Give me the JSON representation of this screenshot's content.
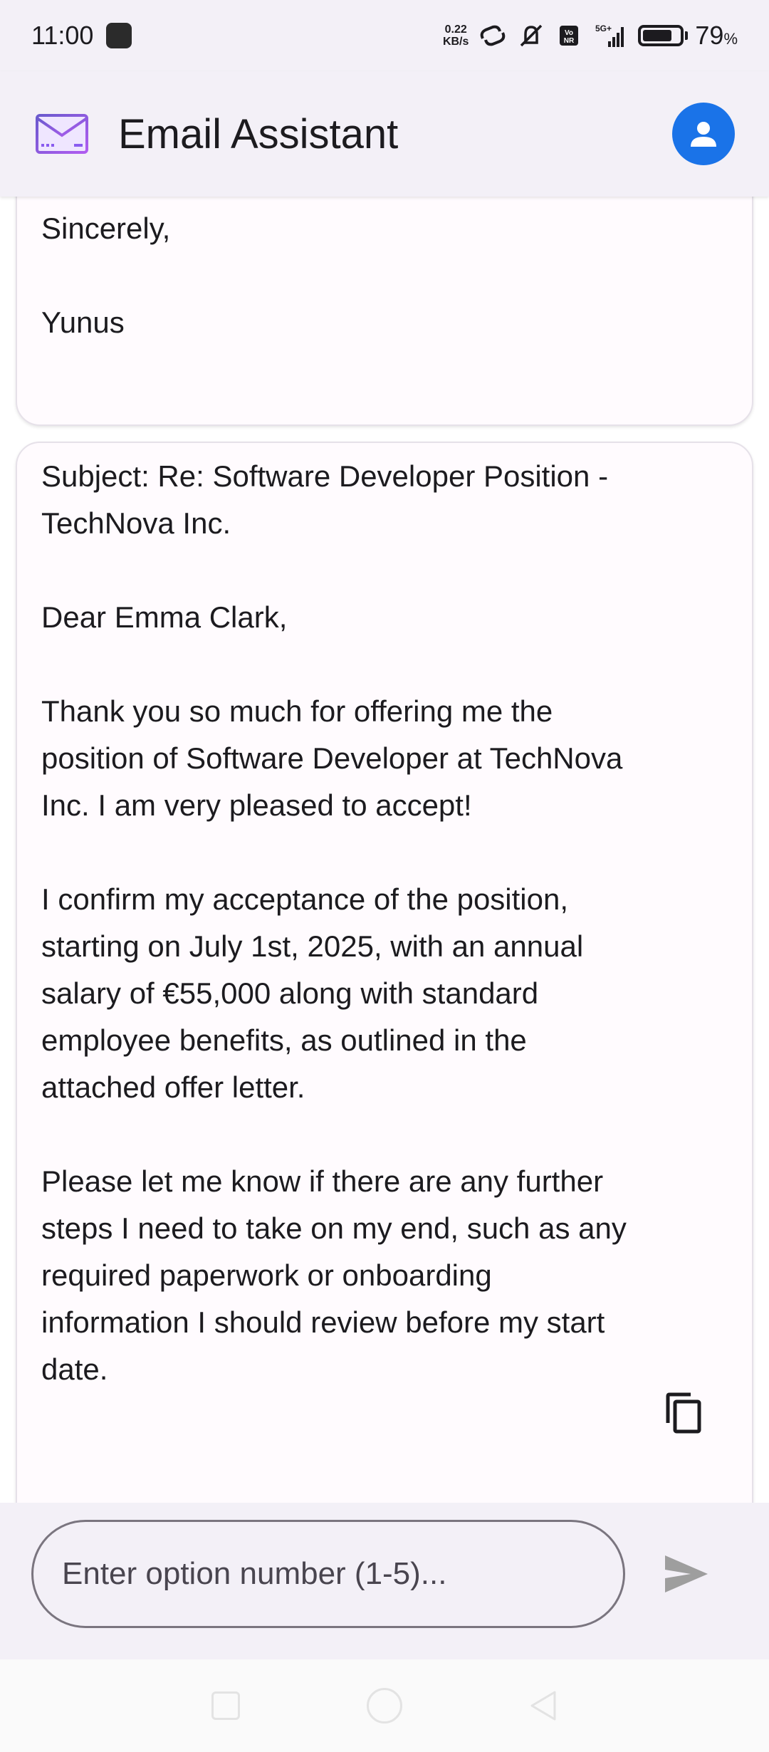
{
  "status_bar": {
    "time": "11:00",
    "speed_value": "0.22",
    "speed_unit": "KB/s",
    "network": "5G+",
    "battery_percent": "79",
    "battery_suffix": "%"
  },
  "app_bar": {
    "title": "Email Assistant",
    "logo_icon": "envelope-icon",
    "profile_icon": "person-icon",
    "accent_color": "#1a73e8"
  },
  "messages": {
    "previous_card": {
      "text": "Sincerely,\n\nYunus"
    },
    "current_card": {
      "text": "Subject: Re: Software Developer Position - TechNova Inc.\n\nDear Emma Clark,\n\nThank you so much for offering me the position of Software Developer at TechNova Inc. I am very pleased to accept!\n\nI confirm my acceptance of the position, starting on July 1st, 2025, with an annual salary of €55,000 along with standard employee benefits, as outlined in the attached offer letter.\n\nPlease let me know if there are any further steps I need to take on my end, such as any required paperwork or onboarding information I should review before my start date.",
      "copy_icon": "copy-icon"
    }
  },
  "input": {
    "placeholder": "Enter option number (1-5)...",
    "value": "",
    "send_icon": "send-icon"
  },
  "nav_bar": {
    "icons": [
      "recents-icon",
      "home-icon",
      "back-icon"
    ]
  }
}
